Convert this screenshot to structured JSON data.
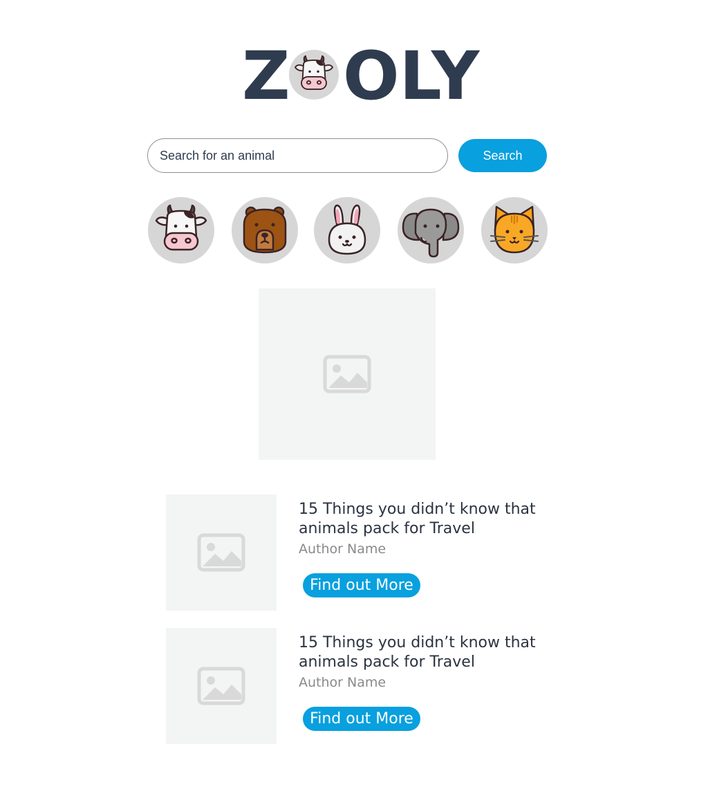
{
  "logo": {
    "left_text": "Z",
    "right_text": "OLY",
    "badge": "cow-face-icon"
  },
  "search": {
    "placeholder": "Search for an animal",
    "value": "",
    "button_label": "Search"
  },
  "animals": [
    {
      "name": "cow",
      "icon": "cow-face-icon"
    },
    {
      "name": "bear",
      "icon": "bear-face-icon"
    },
    {
      "name": "rabbit",
      "icon": "rabbit-face-icon"
    },
    {
      "name": "elephant",
      "icon": "elephant-face-icon"
    },
    {
      "name": "cat",
      "icon": "cat-face-icon"
    }
  ],
  "featured": {
    "icon": "image-placeholder-icon"
  },
  "articles": [
    {
      "title": "15 Things you didn’t know that animals pack for Travel",
      "author": "Author Name",
      "button_label": "Find out More",
      "thumb_icon": "image-placeholder-icon"
    },
    {
      "title": "15 Things you didn’t know that animals pack for Travel",
      "author": "Author Name",
      "button_label": "Find out More",
      "thumb_icon": "image-placeholder-icon"
    }
  ],
  "colors": {
    "brand_dark": "#2f3c4f",
    "accent": "#08a0de",
    "circle_bg": "#d6d6d6",
    "placeholder_bg": "#f3f4f4",
    "muted_text": "#8a8a8a"
  }
}
